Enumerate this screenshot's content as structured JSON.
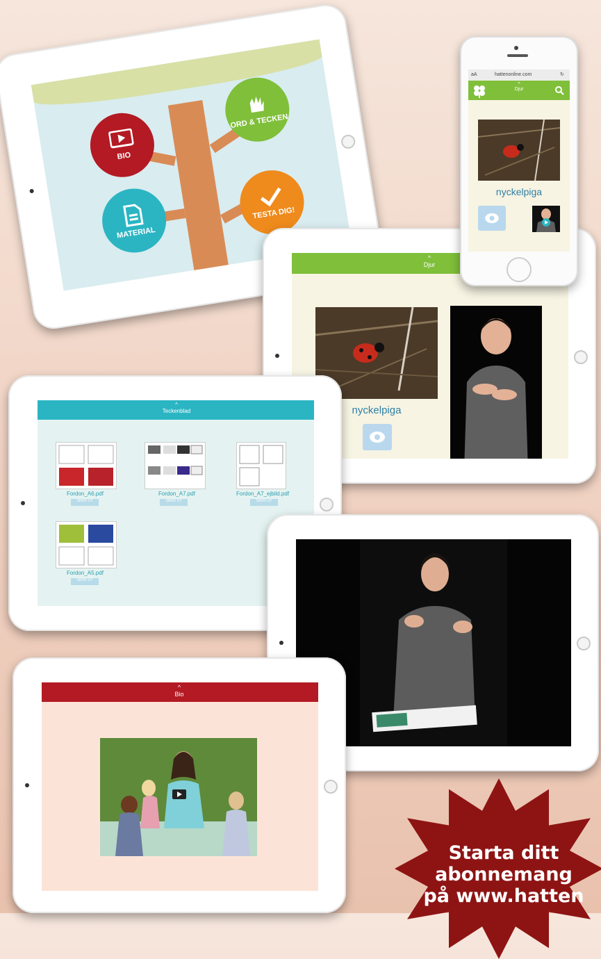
{
  "menu": {
    "bio": "BIO",
    "ord_tecken": "ORD & TECKEN",
    "material": "MATERIAL",
    "testa": "TESTA DIG!"
  },
  "phone": {
    "url": "hattenonline.com",
    "text_size": "aA",
    "category": "Djur",
    "word": "nyckelpiga"
  },
  "flashcard": {
    "category": "Djur",
    "word": "nyckelpiga"
  },
  "worksheets": {
    "title": "Teckenblad",
    "files": [
      {
        "name": "Fordon_A6.pdf",
        "button": "SKRIV UT"
      },
      {
        "name": "Fordon_A7.pdf",
        "button": "SKRIV UT"
      },
      {
        "name": "Fordon_A7_ejbild.pdf",
        "button": "SKRIV UT"
      },
      {
        "name": "Fordon_A5.pdf",
        "button": "SKRIV UT"
      }
    ]
  },
  "bio": {
    "title": "Bio"
  },
  "promo": {
    "line1": "Starta ditt",
    "line2": "abonnemang",
    "line3": "på www.hatten"
  },
  "colors": {
    "bio_red": "#b31a23",
    "ord_green": "#7fbf3a",
    "material_teal": "#2bb5c3",
    "testa_orange": "#ef8a1c",
    "burst_red": "#8e1414"
  }
}
